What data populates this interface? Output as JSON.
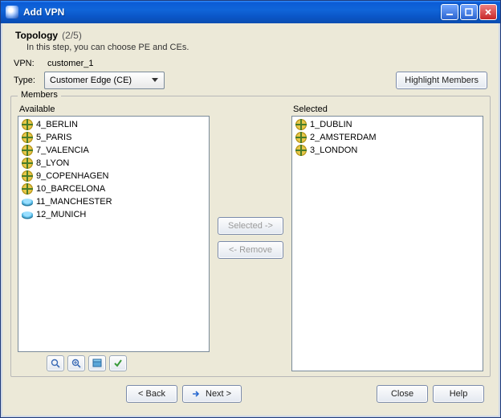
{
  "window": {
    "title": "Add VPN",
    "minimize_tooltip": "Minimize",
    "maximize_tooltip": "Maximize",
    "close_tooltip": "Close"
  },
  "heading": {
    "title": "Topology",
    "step": "(2/5)",
    "subtitle": "In this step, you can choose PE and CEs."
  },
  "vpn": {
    "label": "VPN:",
    "value": "customer_1"
  },
  "type": {
    "label": "Type:",
    "selected": "Customer Edge (CE)"
  },
  "highlight_label": "Highlight Members",
  "members": {
    "legend": "Members",
    "available_label": "Available",
    "selected_label": "Selected",
    "available": [
      {
        "icon": "globe",
        "label": "4_BERLIN"
      },
      {
        "icon": "globe",
        "label": "5_PARIS"
      },
      {
        "icon": "globe",
        "label": "7_VALENCIA"
      },
      {
        "icon": "globe",
        "label": "8_LYON"
      },
      {
        "icon": "globe",
        "label": "9_COPENHAGEN"
      },
      {
        "icon": "globe",
        "label": "10_BARCELONA"
      },
      {
        "icon": "disk",
        "label": "11_MANCHESTER"
      },
      {
        "icon": "disk",
        "label": "12_MUNICH"
      }
    ],
    "selected": [
      {
        "icon": "globe",
        "label": "1_DUBLIN"
      },
      {
        "icon": "globe",
        "label": "2_AMSTERDAM"
      },
      {
        "icon": "globe",
        "label": "3_LONDON"
      }
    ],
    "move_right_label": "Selected ->",
    "move_left_label": "<- Remove"
  },
  "toolbar": {
    "tool1": "magnifier-icon",
    "tool2": "magnifier-plus-icon",
    "tool3": "box-icon",
    "tool4": "check-icon"
  },
  "footer": {
    "back": "< Back",
    "next": "Next >",
    "close": "Close",
    "help": "Help"
  }
}
